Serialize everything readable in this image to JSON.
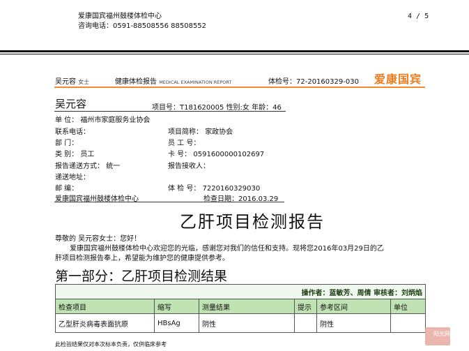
{
  "header": {
    "hospital_name": "爱康国宾福州鼓楼体检中心",
    "phone_label": "咨询电话：",
    "phone_numbers": "0591-88508556   88508552",
    "page_number": "4 / 5"
  },
  "banner": {
    "patient_name": "吴元容",
    "gender": "女士",
    "report_title_cn": "健康体检报告",
    "report_title_en": "MEDICAL EXAMINATION REPORT",
    "exam_number": "体检号：72-20160329-030",
    "logo": "爱康国宾"
  },
  "patient": {
    "name": "吴元容",
    "project_number": "项目号：T181620005",
    "gender": "性别:女",
    "age": "年龄：46",
    "unit_label": "单    位：",
    "unit_value": "福州市家庭服务业协会",
    "contact_label": "联系电话：",
    "project_short_label": "项目简称：",
    "project_short_value": "家政协会",
    "dept_label": "部    门：",
    "employee_no_label": "员  工  号：",
    "category_label": "类    别：",
    "category_value": "员工",
    "card_label": "卡      号：",
    "card_value": "0591600000102697",
    "delivery_label": "报告递送方式：",
    "delivery_value": "统一",
    "receiver_label": "报告接收人：",
    "address_label": "递送地址：",
    "postcode_label": "邮        编：",
    "exam_no_label": "体  检  号：",
    "exam_no_value": "7220160329030",
    "center_name": "爱康国宾福州鼓楼体检中心",
    "exam_date": "检查日期：2016.03.29"
  },
  "report": {
    "title": "乙肝项目检测报告",
    "greeting": "尊敬的 吴元容女士：您好！",
    "body_line1": "爱康国宾福州鼓楼体检中心欢迎您的光临，感谢您对我们的信任和支持。现将您2016年03月29日的乙",
    "body_line2": "肝项目检测报告奉上，希望能为维护您的健康提供参考。",
    "section_title": "第一部分：乙肝项目检测结果"
  },
  "table": {
    "operators": "操作者：蓝敏芳、周倩   审核者：刘炳焰",
    "headers": [
      "检查项目",
      "缩写",
      "测量结果",
      "提示",
      "参考区间",
      "单位"
    ],
    "rows": [
      [
        "乙型肝炎病毒表面抗原",
        "HBsAg",
        "阴性",
        "",
        "阴性",
        ""
      ]
    ]
  },
  "footer": {
    "disclaimer": "此检验结果仅对本次标本负责，仅供临床参考",
    "watermark": "阳光网"
  }
}
